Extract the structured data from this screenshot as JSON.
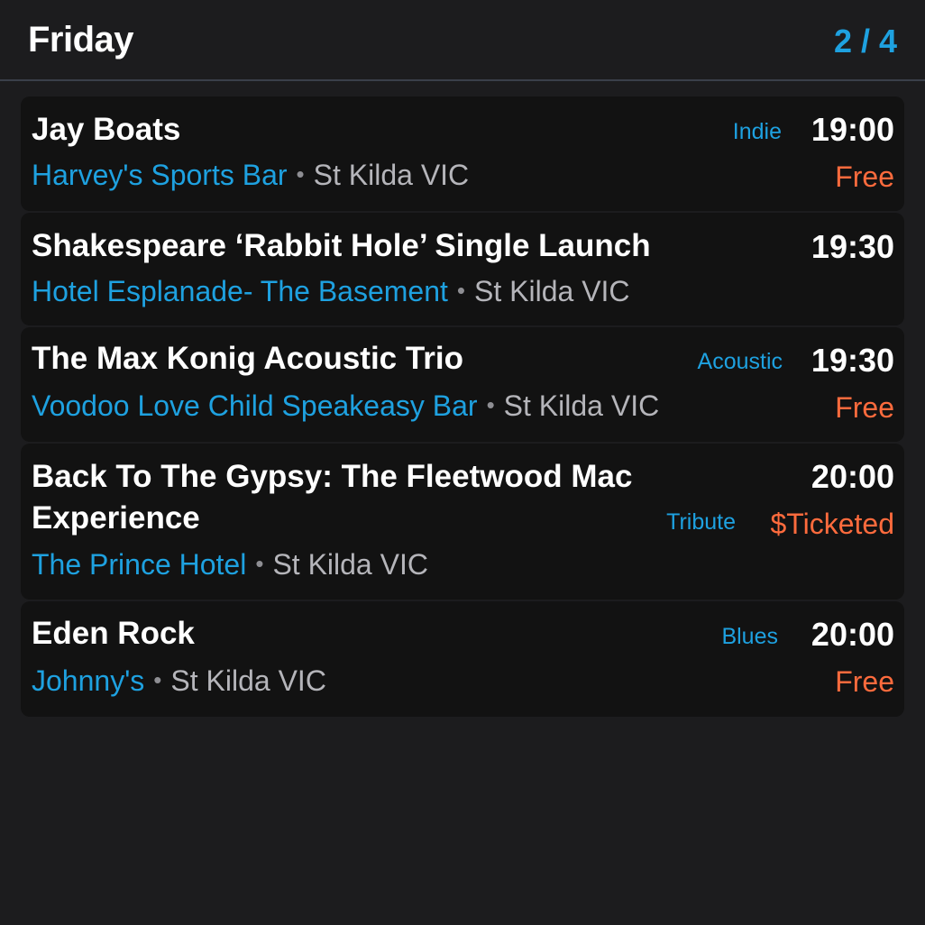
{
  "header": {
    "day": "Friday",
    "page": "2 / 4"
  },
  "events": [
    {
      "title": "Jay Boats",
      "genre": "Indie",
      "time": "19:00",
      "venue": "Harvey's Sports Bar",
      "location": "St Kilda VIC",
      "price": "Free"
    },
    {
      "title": "Shakespeare ‘Rabbit Hole’ Single Launch",
      "genre": "",
      "time": "19:30",
      "venue": "Hotel Esplanade- The Basement",
      "location": "St Kilda VIC",
      "price": ""
    },
    {
      "title": "The Max Konig Acoustic Trio",
      "genre": "Acoustic",
      "time": "19:30",
      "venue": "Voodoo Love Child Speakeasy Bar",
      "location": "St Kilda VIC",
      "price": "Free"
    },
    {
      "title_line1": "Back To The Gypsy: The Fleetwood Mac",
      "title_line2": "Experience",
      "genre": "Tribute",
      "time": "20:00",
      "venue": "The Prince Hotel",
      "location": "St Kilda VIC",
      "price": "$Ticketed"
    },
    {
      "title": "Eden Rock",
      "genre": "Blues",
      "time": "20:00",
      "venue": "Johnny's",
      "location": "St Kilda VIC",
      "price": "Free"
    }
  ],
  "separator": "•",
  "colors": {
    "background": "#1c1c1e",
    "card": "#121212",
    "accent": "#1ea1e0",
    "price": "#ff6b3d",
    "location": "#b5b5ba"
  }
}
